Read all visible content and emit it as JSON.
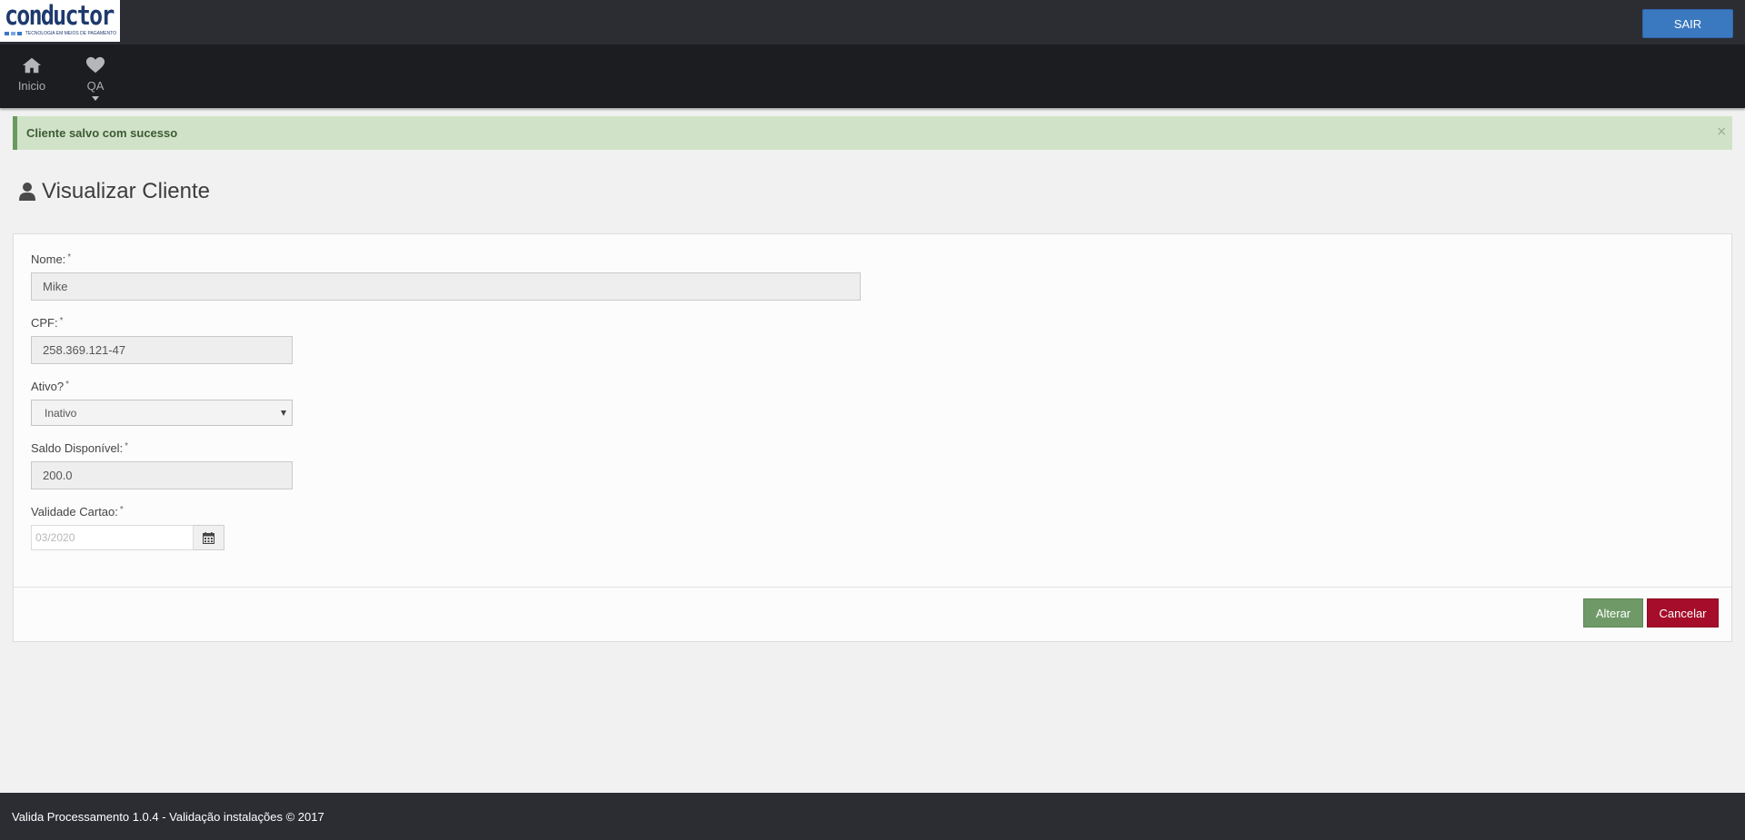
{
  "header": {
    "logo_text": "conductor",
    "logo_tagline": "TECNOLOGIA EM MEIOS DE PAGAMENTO",
    "logout_label": "SAIR"
  },
  "nav": {
    "items": [
      {
        "label": "Inicio",
        "icon": "home-icon"
      },
      {
        "label": "QA",
        "icon": "heart-icon"
      }
    ]
  },
  "alert": {
    "message": "Cliente salvo com sucesso",
    "close_symbol": "×"
  },
  "page": {
    "title": "Visualizar Cliente",
    "title_icon": "user-icon"
  },
  "form": {
    "nome": {
      "label": "Nome:",
      "required": "*",
      "value": "Mike"
    },
    "cpf": {
      "label": "CPF:",
      "required": "*",
      "value": "258.369.121-47"
    },
    "ativo": {
      "label": "Ativo?",
      "required": "*",
      "selected": "Inativo"
    },
    "saldo": {
      "label": "Saldo Disponível:",
      "required": "*",
      "value": "200.0"
    },
    "validade": {
      "label": "Validade Cartao:",
      "required": "*",
      "placeholder": "03/2020",
      "icon": "calendar-icon"
    }
  },
  "actions": {
    "alterar_label": "Alterar",
    "cancelar_label": "Cancelar"
  },
  "footer": {
    "text": "Valida Processamento 1.0.4 - Validação instalações © 2017"
  },
  "colors": {
    "topbar": "#2b2d33",
    "navbar": "#1c1d21",
    "primary": "#3a78bf",
    "success": "#6f9a68",
    "danger": "#a50d2a",
    "alert_bg": "#d0e3c8"
  }
}
